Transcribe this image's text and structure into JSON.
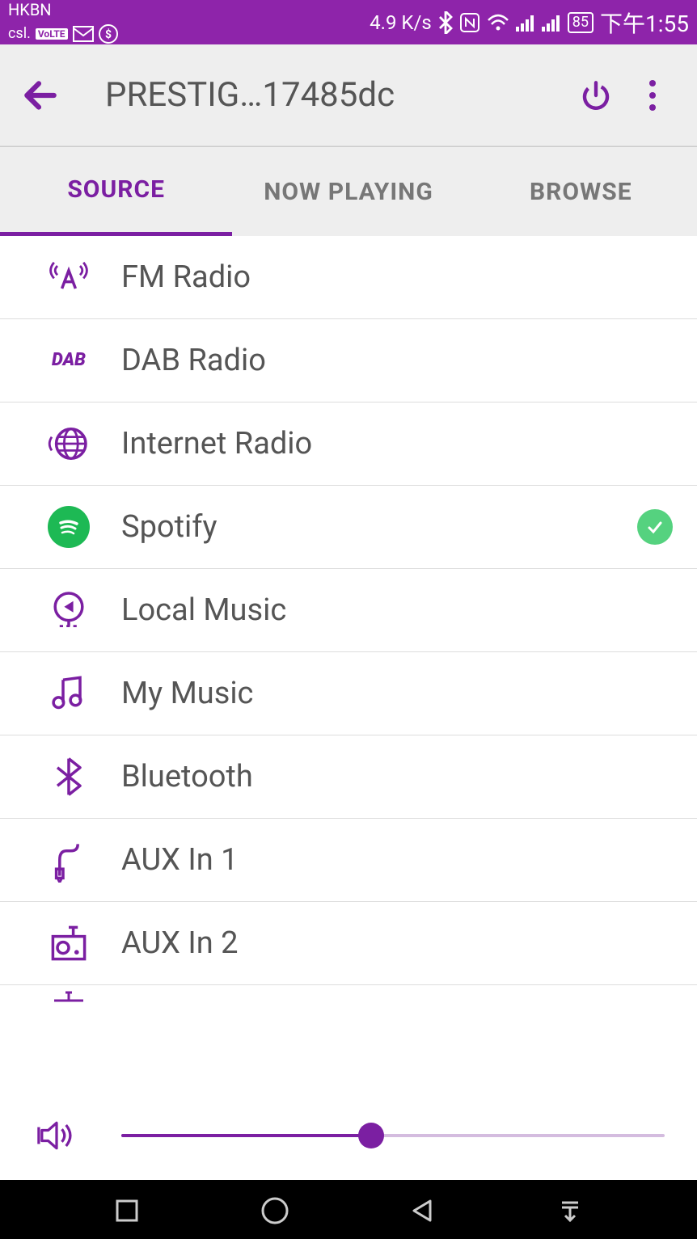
{
  "status": {
    "carrier_top": "HKBN",
    "carrier_bottom": "csl.",
    "volte": "VoLTE",
    "speed": "4.9 K/s",
    "battery": "85",
    "clock": "下午1:55"
  },
  "header": {
    "title": "PRESTIG…17485dc"
  },
  "tabs": {
    "source": "SOURCE",
    "now_playing": "NOW PLAYING",
    "browse": "BROWSE",
    "active": "source"
  },
  "sources": [
    {
      "id": "fm",
      "label": "FM Radio",
      "selected": false
    },
    {
      "id": "dab",
      "label": "DAB Radio",
      "selected": false
    },
    {
      "id": "internet",
      "label": "Internet Radio",
      "selected": false
    },
    {
      "id": "spotify",
      "label": "Spotify",
      "selected": true
    },
    {
      "id": "local",
      "label": "Local Music",
      "selected": false
    },
    {
      "id": "mymusic",
      "label": "My Music",
      "selected": false
    },
    {
      "id": "bluetooth",
      "label": "Bluetooth",
      "selected": false
    },
    {
      "id": "aux1",
      "label": "AUX In 1",
      "selected": false
    },
    {
      "id": "aux2",
      "label": "AUX In 2",
      "selected": false
    }
  ],
  "volume": {
    "percent": 46
  },
  "colors": {
    "accent": "#7b1fa2",
    "status_bg": "#8e24aa",
    "check": "#55d27f",
    "spotify": "#1db954"
  }
}
